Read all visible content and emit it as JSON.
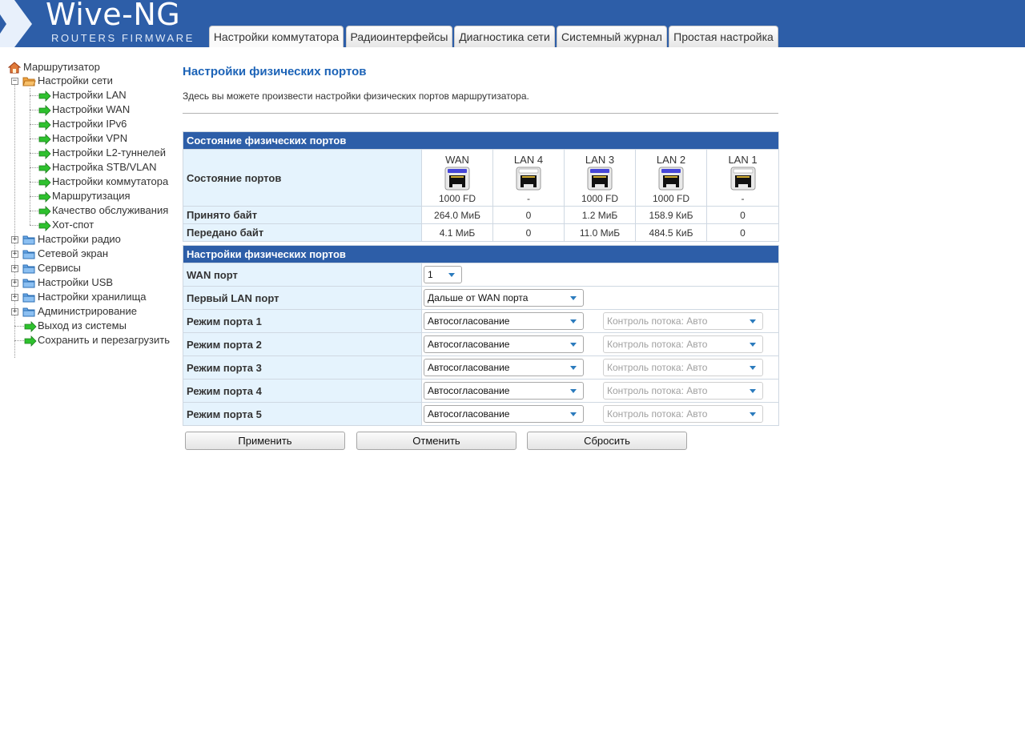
{
  "header": {
    "logo_title": "Wive-NG",
    "logo_subtitle": "ROUTERS FIRMWARE",
    "tabs": [
      {
        "label": "Настройки коммутатора",
        "active": true
      },
      {
        "label": "Радиоинтерфейсы"
      },
      {
        "label": "Диагностика сети"
      },
      {
        "label": "Системный журнал"
      },
      {
        "label": "Простая настройка"
      }
    ]
  },
  "sidebar": {
    "root": "Маршрутизатор",
    "network": {
      "label": "Настройки сети",
      "children": [
        "Настройки LAN",
        "Настройки WAN",
        "Настройки IPv6",
        "Настройки VPN",
        "Настройки L2-туннелей",
        "Настройка STB/VLAN",
        "Настройки коммутатора",
        "Маршрутизация",
        "Качество обслуживания",
        "Хот-спот"
      ]
    },
    "folders": [
      "Настройки радио",
      "Сетевой экран",
      "Сервисы",
      "Настройки USB",
      "Настройки хранилища",
      "Администрирование"
    ],
    "leaves": [
      "Выход из системы",
      "Сохранить и перезагрузить"
    ]
  },
  "main": {
    "title": "Настройки физических портов",
    "description": "Здесь вы можете произвести настройки физических портов маршрутизатора.",
    "status": {
      "header": "Состояние физических портов",
      "row_ports_label": "Состояние портов",
      "row_rx_label": "Принято байт",
      "row_tx_label": "Передано байт",
      "ports": [
        {
          "name": "WAN",
          "speed": "1000 FD",
          "rx": "264.0 МиБ",
          "tx": "4.1 МиБ",
          "link": true
        },
        {
          "name": "LAN 4",
          "speed": "-",
          "rx": "0",
          "tx": "0",
          "link": false
        },
        {
          "name": "LAN 3",
          "speed": "1000 FD",
          "rx": "1.2 МиБ",
          "tx": "11.0 МиБ",
          "link": true
        },
        {
          "name": "LAN 2",
          "speed": "1000 FD",
          "rx": "158.9 КиБ",
          "tx": "484.5 КиБ",
          "link": true
        },
        {
          "name": "LAN 1",
          "speed": "-",
          "rx": "0",
          "tx": "0",
          "link": false
        }
      ]
    },
    "settings": {
      "header": "Настройки физических портов",
      "wan_port": {
        "label": "WAN порт",
        "value": "1"
      },
      "first_lan": {
        "label": "Первый LAN порт",
        "value": "Дальше от WAN порта"
      },
      "port_modes": [
        {
          "label": "Режим порта 1",
          "mode": "Автосогласование",
          "flow": "Контроль потока: Авто"
        },
        {
          "label": "Режим порта 2",
          "mode": "Автосогласование",
          "flow": "Контроль потока: Авто"
        },
        {
          "label": "Режим порта 3",
          "mode": "Автосогласование",
          "flow": "Контроль потока: Авто"
        },
        {
          "label": "Режим порта 4",
          "mode": "Автосогласование",
          "flow": "Контроль потока: Авто"
        },
        {
          "label": "Режим порта 5",
          "mode": "Автосогласование",
          "flow": "Контроль потока: Авто"
        }
      ]
    },
    "buttons": {
      "apply": "Применить",
      "cancel": "Отменить",
      "reset": "Сбросить"
    }
  },
  "colors": {
    "header_bg": "#2d5ea8",
    "title_blue": "#1c63b7",
    "label_cell_bg": "#e5f3fd",
    "port_link_led": "#4646d8"
  }
}
